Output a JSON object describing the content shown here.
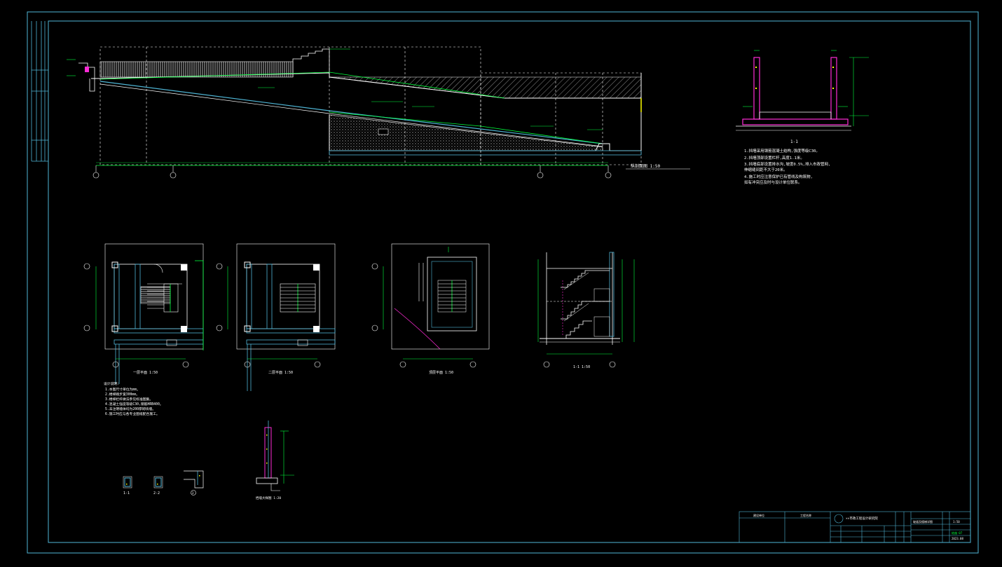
{
  "drawing": {
    "section_1_label": "1-1",
    "section_scale_label": "1:50",
    "longitudinal_title": "纵剖面图 1:50",
    "stair_plan_1_title": "一层平面 1:50",
    "stair_plan_2_title": "二层平面 1:50",
    "stair_plan_3_title": "顶层平面 1:50",
    "stair_section_title": "1-1 1:50",
    "wall_detail_title": "挡墙大样图 1:20",
    "detail_labels": [
      "1-1",
      "2-2",
      "3"
    ]
  },
  "section_notes": [
    "1.挡墙采用钢筋混凝土结构,强度等级C30。",
    "2.挡墙顶部设置栏杆,高度1.1米。",
    "3.挡墙底部设置排水沟,坡度0.5%,排入市政管网,",
    "  伸缩缝间距不大于20米。",
    "4.施工时应注意保护已有管线及构筑物,",
    "  如有冲突应及时与设计单位联系。"
  ],
  "general_notes": [
    "设计说明:",
    "1.本图尺寸单位为mm。",
    "2.楼梯踏步宽300mm。",
    "3.楼梯栏杆做法参见标准图集。",
    "4.混凝土强度等级C30,钢筋HRB400。",
    "5.未注明墙体均为200厚砌块墙。",
    "6.施工时应与各专业图纸配合施工。"
  ],
  "title_block": {
    "company": "××市政工程设计研究院",
    "col_1": "建设单位",
    "col_2": "工程名称",
    "sheet_title": "坡道及楼梯详图",
    "scale": "1:50",
    "sheet_no": "结施-07",
    "date": "2023.08"
  },
  "colors": {
    "frame": "#4fb6d6",
    "concrete": "#ffffff",
    "slope": "#00ff3c",
    "dimension": "#00ff3c",
    "magenta": "#ff2bd6",
    "yellow": "#ffff00",
    "grid": "#a0a0a0"
  }
}
